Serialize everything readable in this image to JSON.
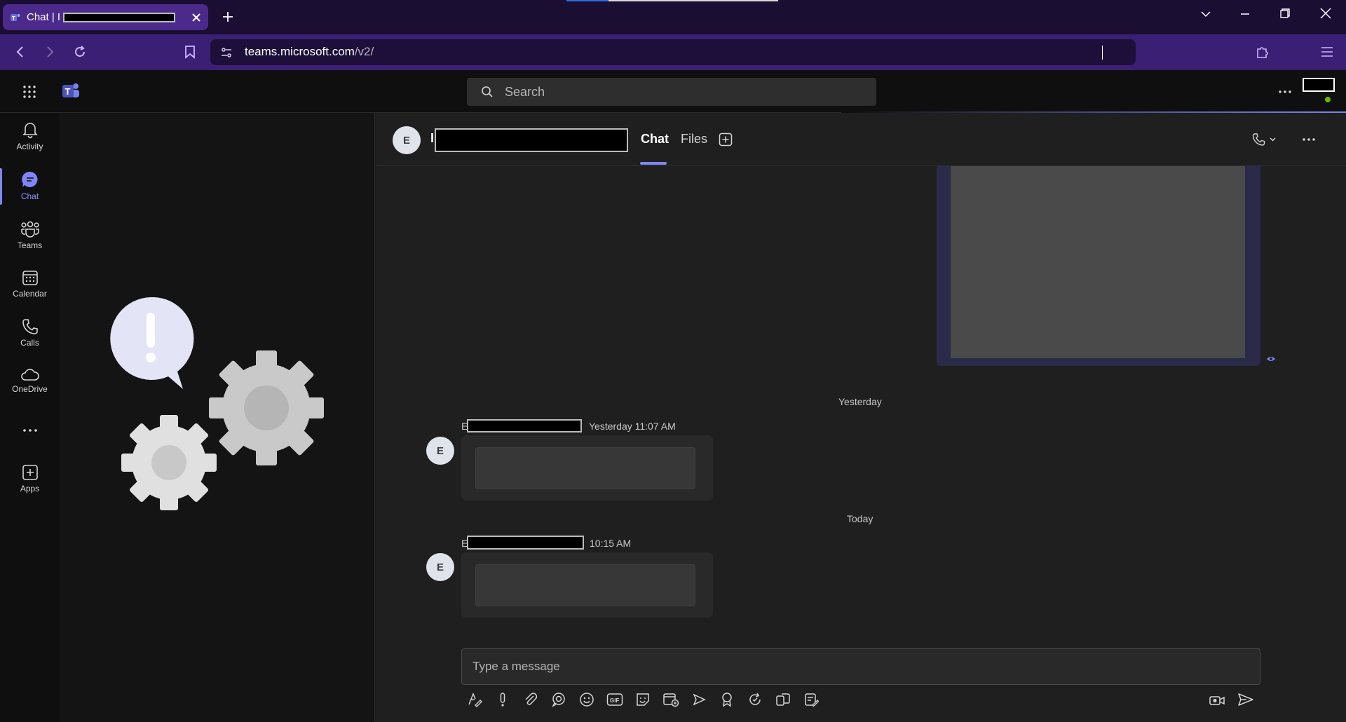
{
  "browser": {
    "tab_title": "Chat | I",
    "url_host": "teams.microsoft.com",
    "url_path": "/v2/"
  },
  "teams": {
    "search_placeholder": "Search"
  },
  "rail": {
    "items": [
      {
        "label": "Activity"
      },
      {
        "label": "Chat"
      },
      {
        "label": "Teams"
      },
      {
        "label": "Calendar"
      },
      {
        "label": "Calls"
      },
      {
        "label": "OneDrive"
      },
      {
        "label": "Apps"
      }
    ]
  },
  "chat": {
    "contact_initial": "E",
    "contact_name_prefix": "I",
    "tabs": [
      {
        "label": "Chat"
      },
      {
        "label": "Files"
      }
    ],
    "day_yesterday": "Yesterday",
    "day_today": "Today",
    "messages": [
      {
        "initial": "E",
        "sender_prefix": "E",
        "time": "Yesterday 11:07 AM"
      },
      {
        "initial": "E",
        "sender_prefix": "E",
        "time": "10:15 AM"
      }
    ],
    "composer_placeholder": "Type a message"
  },
  "colors": {
    "accent": "#7f85f5",
    "browser_tab": "#4b2a8c",
    "toolbar": "#3a1f74"
  }
}
